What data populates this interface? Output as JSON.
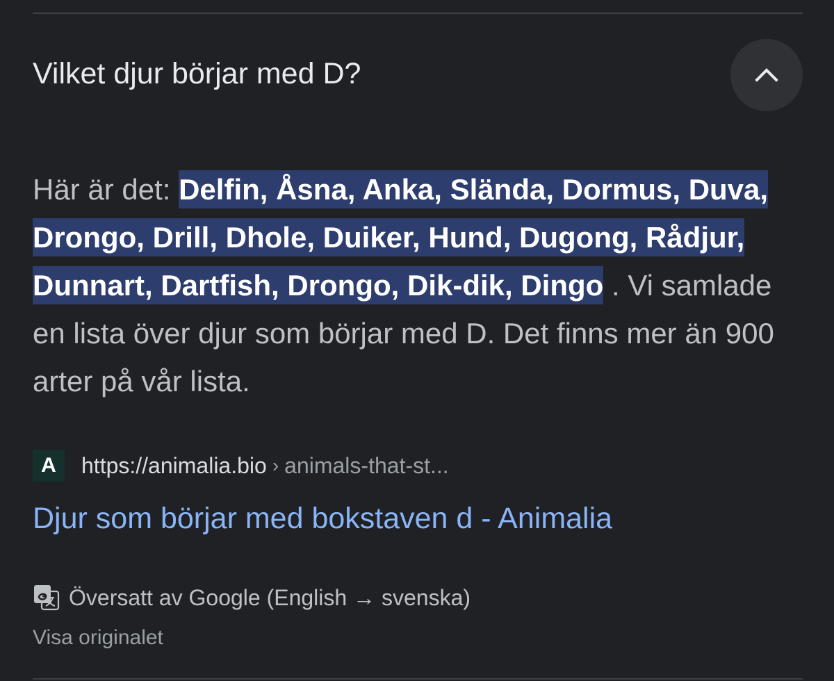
{
  "faq": {
    "question": "Vilket djur börjar med D?",
    "collapse_icon": "chevron-up-icon",
    "answer": {
      "intro": "Här är det: ",
      "highlight": "Delfin, Åsna, Anka, Slända, Dormus, Duva, Drongo, Drill, Dhole, Duiker, Hund, Dugong, Rådjur, Dunnart, Dartfish, Drongo, Dik-dik, Dingo",
      "after_highlight": " .",
      "rest": " Vi samlade en lista över djur som börjar med D. Det finns mer än 900 arter på vår lista."
    }
  },
  "source": {
    "favicon_letter": "A",
    "url_host": "https://animalia.bio",
    "url_separator": "›",
    "url_path": "animals-that-st...",
    "title": "Djur som börjar med bokstaven d - Animalia"
  },
  "translation": {
    "icon": "google-translate-icon",
    "text": "Översatt av Google (English → svenska)",
    "show_original": "Visa originalet"
  },
  "colors": {
    "background": "#202124",
    "highlight_bg": "#2d3d6e",
    "link": "#8ab4f8",
    "divider": "#3c4043"
  }
}
